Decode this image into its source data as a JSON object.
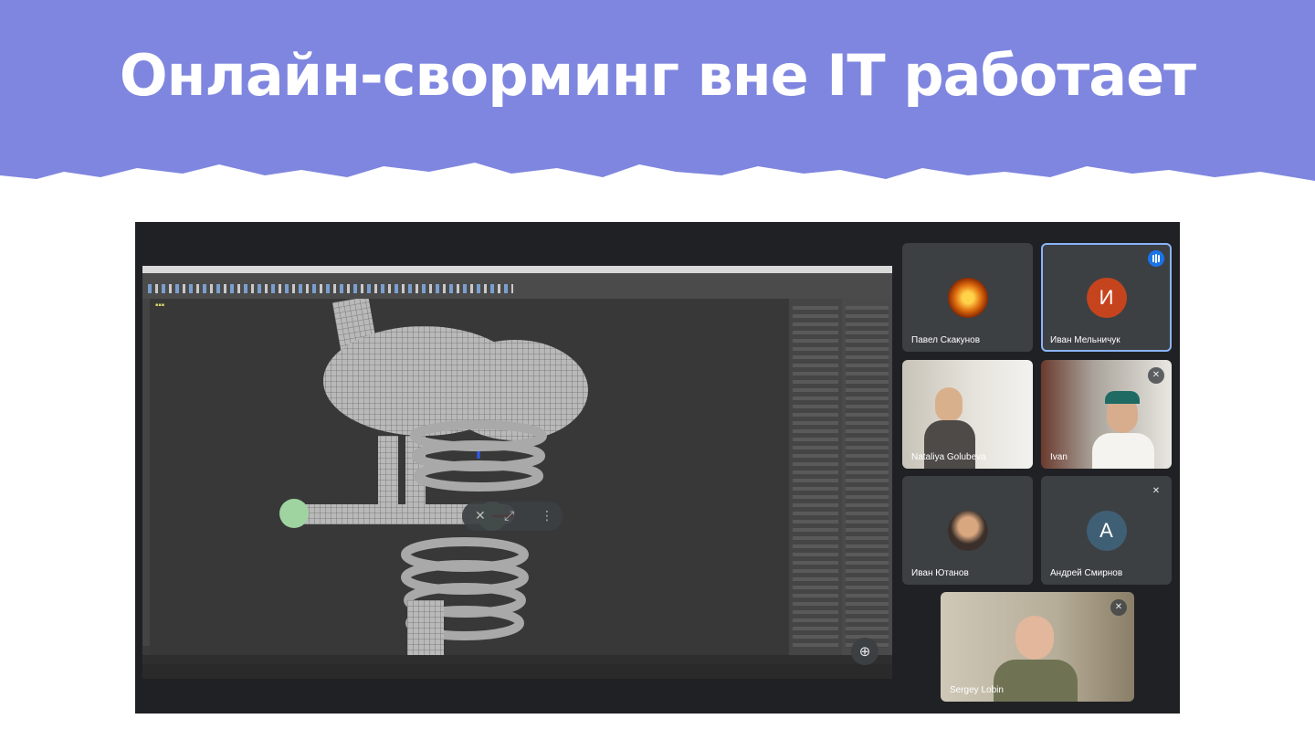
{
  "slide": {
    "title": "Онлайн-сворминг вне IT работает",
    "banner_color": "#7f86df"
  },
  "meet": {
    "background": "#202124",
    "share_controls": [
      "pin-off-icon",
      "fullscreen-icon",
      "more-vert-icon"
    ],
    "zoom_icon": "zoom-in-icon",
    "participants": [
      {
        "name": "Павел Скакунов",
        "avatar_type": "image",
        "muted": false
      },
      {
        "name": "Иван Мельничук",
        "avatar_letter": "И",
        "avatar_color": "#c5441e",
        "speaking": true
      },
      {
        "name": "Nataliya Golubeva",
        "avatar_type": "video",
        "muted": false
      },
      {
        "name": "Ivan",
        "avatar_type": "video",
        "muted": true
      },
      {
        "name": "Иван Ютанов",
        "avatar_type": "image",
        "muted": false
      },
      {
        "name": "Андрей Смирнов",
        "avatar_letter": "A",
        "avatar_color": "#3f5f75",
        "muted": true
      },
      {
        "name": "Sergey Lobin",
        "avatar_type": "video",
        "muted": true
      }
    ]
  }
}
